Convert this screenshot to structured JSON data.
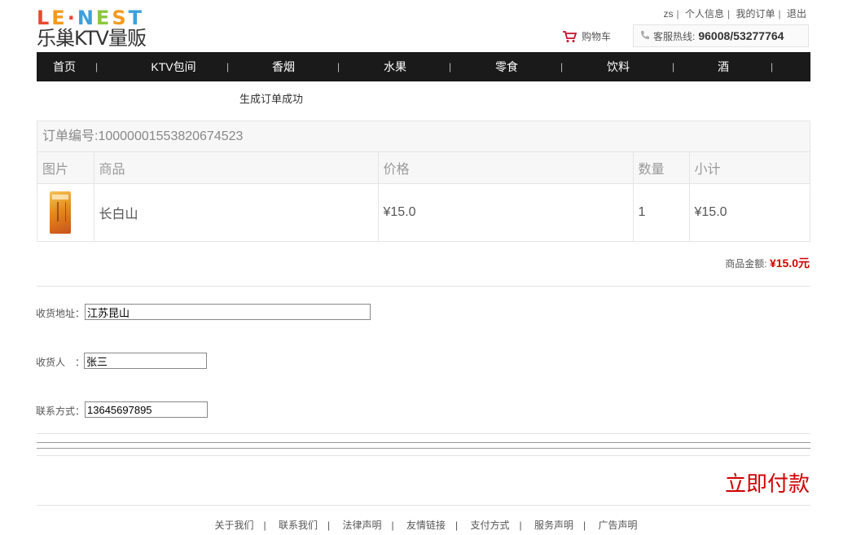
{
  "logo": {
    "letters": [
      "L",
      "E",
      "·",
      "N",
      "E",
      "S",
      "T"
    ],
    "letter_colors": [
      "#e8492e",
      "#f39a1e",
      "#e8492e",
      "#3ca0dc",
      "#8cc63f",
      "#f39a1e",
      "#3ca0dc"
    ],
    "tagline": "乐巢KTV量贩"
  },
  "header": {
    "user": "zs",
    "links": [
      "个人信息",
      "我的订单",
      "退出"
    ],
    "cart_label": "购物车",
    "hotline_label": "客服热线:",
    "hotline_number": "96008/53277764"
  },
  "nav": {
    "items": [
      "首页",
      "KTV包间",
      "香烟",
      "水果",
      "零食",
      "饮料",
      "酒"
    ],
    "separator": "|"
  },
  "status": {
    "message": "生成订单成功"
  },
  "order": {
    "number_label": "订单编号:",
    "number": "10000001553820674523",
    "columns": [
      "图片",
      "商品",
      "价格",
      "数量",
      "小计"
    ],
    "rows": [
      {
        "image": "cigarette-pack",
        "name": "长白山",
        "price": "¥15.0",
        "qty": "1",
        "subtotal": "¥15.0"
      }
    ]
  },
  "summary": {
    "label": "商品金额:",
    "amount": "¥15.0元"
  },
  "form": {
    "address_label": "收货地址：",
    "address_value": "江苏昆山",
    "receiver_label": "收货人　：",
    "receiver_value": "张三",
    "phone_label": "联系方式：",
    "phone_value": "13645697895"
  },
  "pay_button": "立即付款",
  "footer": {
    "links": [
      "关于我们",
      "联系我们",
      "法律声明",
      "友情链接",
      "支付方式",
      "服务声明",
      "广告声明"
    ]
  },
  "colors": {
    "accent": "#d10000",
    "nav_bg": "#1a1a1a"
  }
}
